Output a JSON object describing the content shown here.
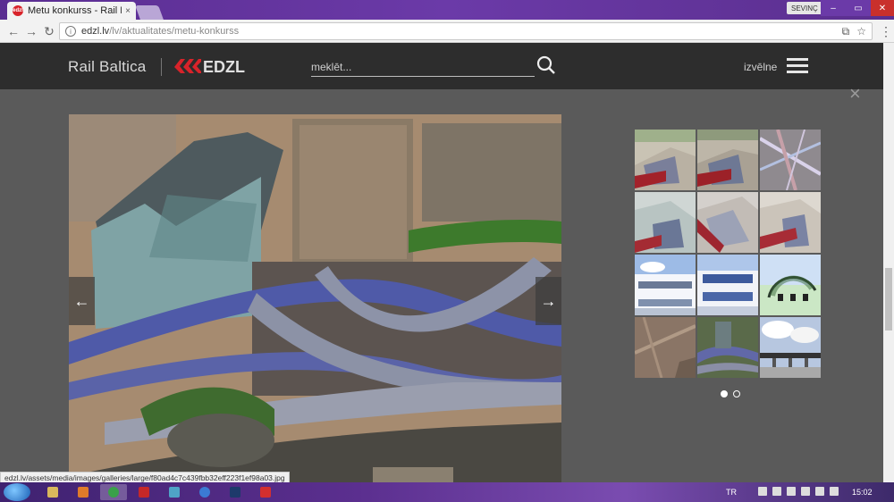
{
  "browser": {
    "tab_title": "Metu konkurss - Rail Balt",
    "tab_close": "×",
    "favicon_text": "edzl",
    "user_name": "SEVINÇ",
    "url_host": "edzl.lv",
    "url_path": "/lv/aktualitates/metu-konkurss",
    "status_url": "edzl.lv/assets/media/images/galleries/large/f80ad4c7c439fbb32eff223f1ef98a03.jpg"
  },
  "header": {
    "brand": "Rail Baltica",
    "edzl": "EDZL",
    "search_placeholder": "meklēt...",
    "menu_label": "izvēlne",
    "accent_color": "#d8232a"
  },
  "lightbox": {
    "close_label": "×",
    "prev_label": "←",
    "next_label": "→",
    "thumbnails": [
      {
        "name": "aerial-plan-1"
      },
      {
        "name": "aerial-plan-2"
      },
      {
        "name": "site-map"
      },
      {
        "name": "aerial-plan-3"
      },
      {
        "name": "aerial-plan-4"
      },
      {
        "name": "aerial-plan-5"
      },
      {
        "name": "elevation-1"
      },
      {
        "name": "elevation-2"
      },
      {
        "name": "station-render"
      },
      {
        "name": "aerial-photo"
      },
      {
        "name": "roads-render"
      },
      {
        "name": "platform-render"
      }
    ],
    "pages": [
      {
        "active": true
      },
      {
        "active": false
      }
    ]
  },
  "taskbar": {
    "language": "TR",
    "time": "15:02"
  }
}
